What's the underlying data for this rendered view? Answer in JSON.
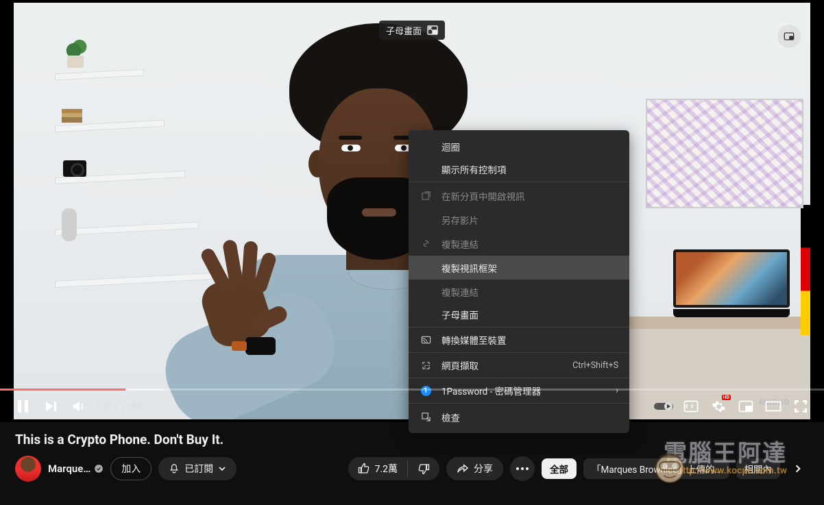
{
  "pip_badge": {
    "label": "子母畫面"
  },
  "video_watermark": "MKBHD",
  "context_menu": {
    "items": [
      {
        "label": "迴圈",
        "icon": "",
        "disabled": false
      },
      {
        "label": "顯示所有控制項",
        "icon": "",
        "disabled": false,
        "sep_after": true
      },
      {
        "label": "在新分頁中開啟視訊",
        "icon": "open-new-tab",
        "disabled": true
      },
      {
        "label": "另存影片",
        "icon": "",
        "disabled": true
      },
      {
        "label": "複製連結",
        "icon": "link",
        "disabled": true
      },
      {
        "label": "複製視訊框架",
        "icon": "",
        "disabled": false,
        "hover": true
      },
      {
        "label": "複製連結",
        "icon": "",
        "disabled": true
      },
      {
        "label": "子母畫面",
        "icon": "",
        "disabled": false,
        "sep_after": true
      },
      {
        "label": "轉換媒體至裝置",
        "icon": "cast",
        "disabled": false,
        "sep_after": true
      },
      {
        "label": "網頁擷取",
        "icon": "capture",
        "shortcut": "Ctrl+Shift+S",
        "disabled": false,
        "sep_after": true
      },
      {
        "label": "1Password - 密碼管理器",
        "icon": "onepassword",
        "submenu": true,
        "disabled": false,
        "sep_after": true
      },
      {
        "label": "檢查",
        "icon": "inspect",
        "disabled": false
      }
    ]
  },
  "player": {
    "current_time": "1:47",
    "duration": "11:48",
    "time_display": "1:47 / 11:48",
    "hd_badge": "HD"
  },
  "video": {
    "title": "This is a Crypto Phone. Don't Buy It.",
    "channel_name": "Marque…",
    "join_label": "加入",
    "subscribed_label": "已訂閱",
    "like_count": "7.2萬",
    "share_label": "分享"
  },
  "chips": {
    "all": "全部",
    "uploaded_prefix": "「Marques Brownlee」上傳的…",
    "related": "相關內"
  },
  "watermark_site": {
    "big": "電腦王阿達",
    "url": "http://www.kocpc.com.tw"
  }
}
